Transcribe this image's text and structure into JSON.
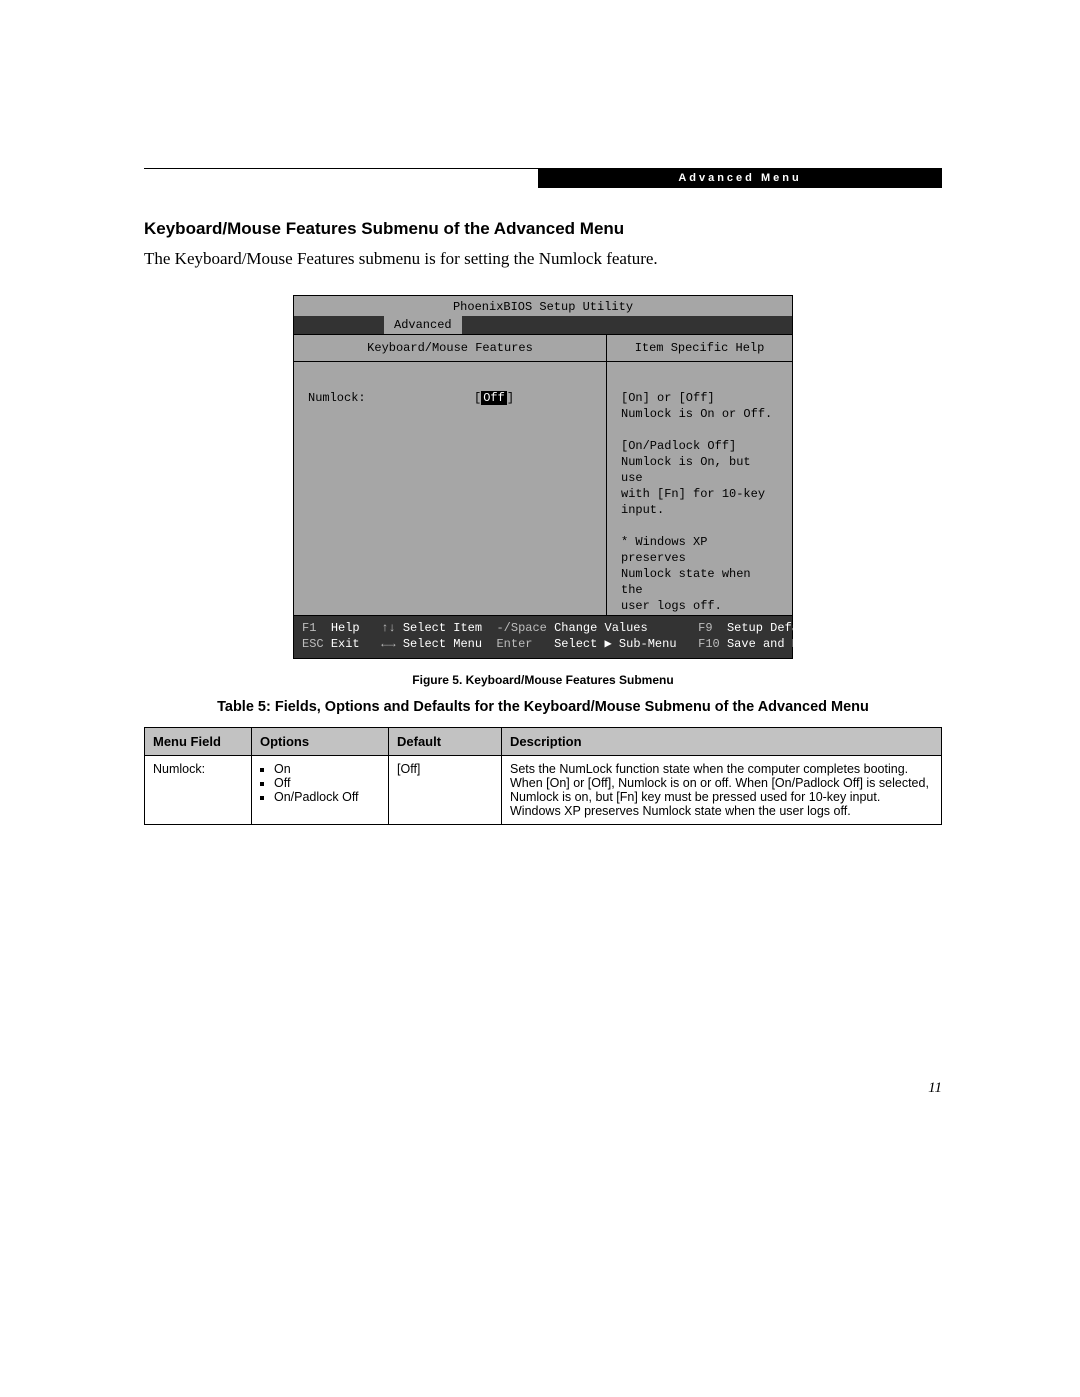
{
  "header_bar": "Advanced Menu",
  "heading": "Keyboard/Mouse Features Submenu of the Advanced Menu",
  "intro": "The Keyboard/Mouse Features submenu is for setting the Numlock feature.",
  "bios": {
    "title": "PhoenixBIOS Setup Utility",
    "tab": "Advanced",
    "left_title": "Keyboard/Mouse Features",
    "right_title": "Item Specific Help",
    "setting_label": "Numlock:",
    "setting_value": "Off",
    "help_text": "[On] or [Off]\nNumlock is On or Off.\n\n[On/Padlock Off]\nNumlock is On, but use\nwith [Fn] for 10-key\ninput.\n\n* Windows XP preserves\nNumlock state when the\nuser logs off.",
    "footer": {
      "f1": "F1",
      "f1_label": "Help",
      "esc": "ESC",
      "esc_label": "Exit",
      "updn": "↑↓",
      "updn_label": "Select Item",
      "lr": "←→",
      "lr_label": "Select Menu",
      "minus": "-/Space",
      "minus_label": "Change Values",
      "enter": "Enter",
      "enter_label": "Select ▶ Sub-Menu",
      "f9": "F9",
      "f9_label": "Setup Defaults",
      "f10": "F10",
      "f10_label": "Save and Exit"
    }
  },
  "figure_caption": "Figure 5.  Keyboard/Mouse Features Submenu",
  "table_title": "Table 5: Fields, Options and Defaults for the Keyboard/Mouse Submenu of the Advanced Menu",
  "table": {
    "headers": [
      "Menu Field",
      "Options",
      "Default",
      "Description"
    ],
    "row": {
      "field": "Numlock:",
      "options": [
        "On",
        "Off",
        "On/Padlock Off"
      ],
      "default": "[Off]",
      "description": "Sets the NumLock function state when the computer completes booting. When [On] or [Off], Numlock is on or off. When [On/Padlock Off] is selected, Numlock is on, but [Fn] key must be pressed used for 10-key input. Windows XP preserves Numlock state when the user logs off."
    }
  },
  "page_number": "11"
}
